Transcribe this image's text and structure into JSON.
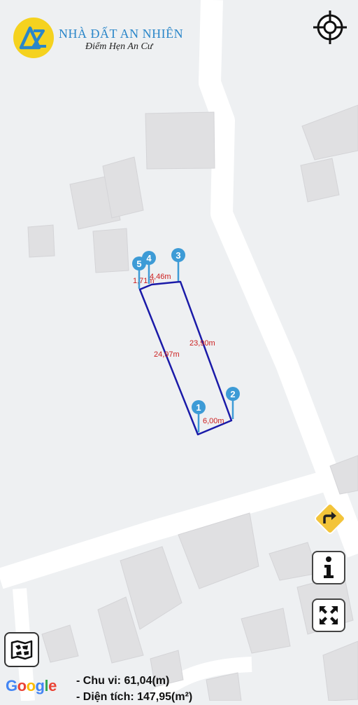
{
  "brand": {
    "name": "NHÀ ĐẤT AN NHIÊN",
    "slogan": "Điểm Hẹn An Cư",
    "colors": {
      "primary": "#2a86c9",
      "badge_fill": "#f5d21f"
    }
  },
  "map": {
    "parcel": {
      "line_color": "#1a1aa8",
      "edge_labels": [
        "6,00m",
        "23,90m",
        "4,46m",
        "1,71m",
        "24,97m"
      ],
      "vertex_labels": [
        "1",
        "2",
        "3",
        "4",
        "5"
      ],
      "marker_color": "#3d9bd6"
    },
    "provider": "Google"
  },
  "controls": {
    "locate_icon": "crosshair-icon",
    "directions_icon": "turn-right-sign-icon",
    "info_icon": "info-icon",
    "fullscreen_icon": "expand-icon",
    "map_type_icon": "map-layers-icon"
  },
  "summary": {
    "perimeter": "- Chu vi: 61,04(m)",
    "area": "- Diện tích: 147,95(m²)"
  }
}
